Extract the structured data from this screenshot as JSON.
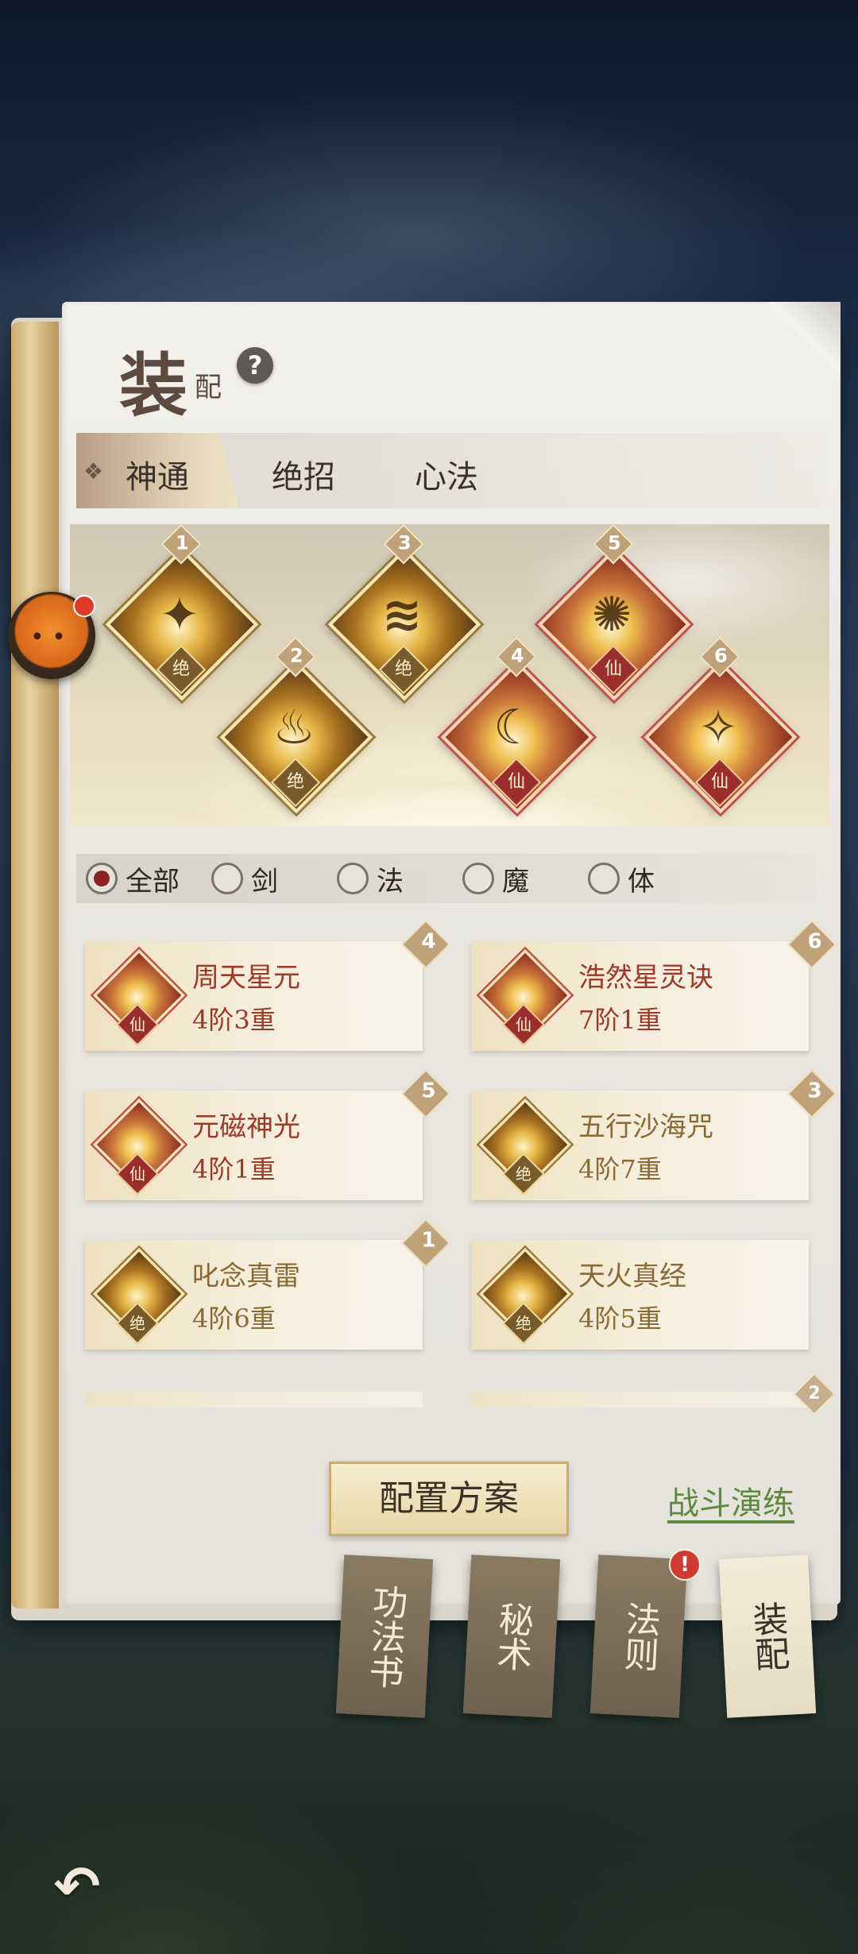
{
  "title": {
    "big": "装",
    "small": "配"
  },
  "help_icon": "?",
  "tabs": [
    {
      "label": "神通",
      "active": true
    },
    {
      "label": "绝招",
      "active": false
    },
    {
      "label": "心法",
      "active": false
    }
  ],
  "tab_active_icon": "❖",
  "slots": [
    {
      "num": "1",
      "tier": "绝",
      "rank": "gold",
      "glyph": "✦"
    },
    {
      "num": "2",
      "tier": "绝",
      "rank": "gold",
      "glyph": "♨"
    },
    {
      "num": "3",
      "tier": "绝",
      "rank": "gold",
      "glyph": "≋"
    },
    {
      "num": "4",
      "tier": "仙",
      "rank": "red",
      "glyph": "☾"
    },
    {
      "num": "5",
      "tier": "仙",
      "rank": "red",
      "glyph": "✺"
    },
    {
      "num": "6",
      "tier": "仙",
      "rank": "red",
      "glyph": "✧"
    }
  ],
  "filters": [
    {
      "label": "全部",
      "selected": true
    },
    {
      "label": "剑",
      "selected": false
    },
    {
      "label": "法",
      "selected": false
    },
    {
      "label": "魔",
      "selected": false
    },
    {
      "label": "体",
      "selected": false
    }
  ],
  "skills": [
    {
      "name": "周天星元",
      "level": "4阶3重",
      "slot": "4",
      "tier": "仙",
      "rank": "red"
    },
    {
      "name": "浩然星灵诀",
      "level": "7阶1重",
      "slot": "6",
      "tier": "仙",
      "rank": "red"
    },
    {
      "name": "元磁神光",
      "level": "4阶1重",
      "slot": "5",
      "tier": "仙",
      "rank": "red"
    },
    {
      "name": "五行沙海咒",
      "level": "4阶7重",
      "slot": "3",
      "tier": "绝",
      "rank": "gold"
    },
    {
      "name": "叱念真雷",
      "level": "4阶6重",
      "slot": "1",
      "tier": "绝",
      "rank": "gold"
    },
    {
      "name": "天火真经",
      "level": "4阶5重",
      "slot": "",
      "tier": "绝",
      "rank": "gold"
    }
  ],
  "partial_slot": "2",
  "plan_button": "配置方案",
  "battle_link": "战斗演练",
  "bookmarks": [
    {
      "label": "功法书",
      "active": false
    },
    {
      "label": "秘术",
      "active": false
    },
    {
      "label": "法则",
      "active": false,
      "badge": "!"
    },
    {
      "label": "装配",
      "active": true
    }
  ],
  "back_icon": "↶",
  "pet_face": "• •"
}
